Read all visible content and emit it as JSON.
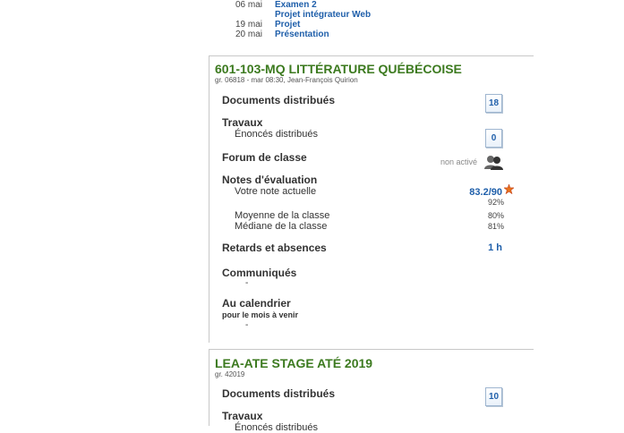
{
  "top_list": [
    {
      "date": "06 mai",
      "label": "Examen 2"
    },
    {
      "date": "",
      "label": "Projet intégrateur Web"
    },
    {
      "date": "19 mai",
      "label": "Projet"
    },
    {
      "date": "20 mai",
      "label": "Présentation"
    }
  ],
  "course1": {
    "title": "601-103-MQ LITTÉRATURE QUÉBÉCOISE",
    "subtitle": "gr. 06818 - mar 08:30, Jean-François Quirion",
    "documents_label": "Documents distribués",
    "documents_count": "18",
    "travaux_label": "Travaux",
    "enonces_label": "Énoncés distribués",
    "enonces_count": "0",
    "forum_label": "Forum de classe",
    "forum_status": "non activé",
    "notes_label": "Notes d'évaluation",
    "note_label": "Votre note actuelle",
    "note_value": "83.2/90",
    "note_percent": "92%",
    "moyenne_label": "Moyenne de la classe",
    "moyenne_value": "80%",
    "mediane_label": "Médiane de la classe",
    "mediane_value": "81%",
    "retards_label": "Retards et absences",
    "retards_value": "1 h",
    "communiques_label": "Communiqués",
    "communiques_value": "-",
    "calendrier_label": "Au calendrier",
    "calendrier_sub": "pour le mois à venir",
    "calendrier_value": "-"
  },
  "course2": {
    "title": "LEA-ATE STAGE ATÉ 2019",
    "subtitle": "gr. 42019",
    "documents_label": "Documents distribués",
    "documents_count": "10",
    "travaux_label": "Travaux",
    "enonces_label": "Énoncés distribués"
  },
  "colors": {
    "course_title": "#3c7a1f",
    "link": "#1f5faa"
  }
}
